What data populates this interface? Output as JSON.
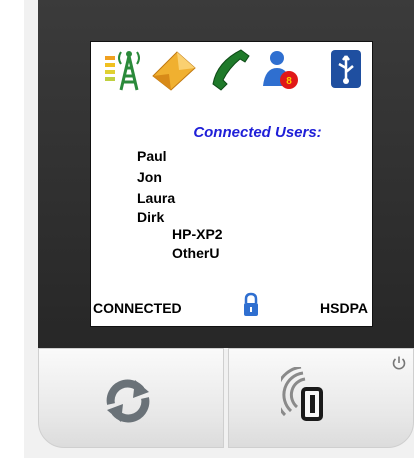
{
  "screen": {
    "title": "Connected Users:",
    "users": [
      "Paul",
      "Jon",
      "Laura",
      "Dirk"
    ],
    "sub_users": [
      "HP-XP2",
      "OtherU"
    ],
    "connection_status": "CONNECTED",
    "network_type": "HSDPA"
  },
  "icons": {
    "signal": "signal-tower-icon",
    "message": "envelope-icon",
    "call": "phone-handset-icon",
    "users": "users-icon",
    "usb": "usb-icon",
    "lock": "lock-icon",
    "refresh": "refresh-icon",
    "wps": "wps-icon",
    "power": "power-icon"
  },
  "colors": {
    "title": "#1f1fd8",
    "tower": "#2a8a3a",
    "envelope": "#f0a020",
    "phone": "#1f7a2a",
    "users_badge": "#e01818",
    "usb_bg": "#1f4fa0",
    "lock": "#2f6fd0",
    "refresh": "#6a7278"
  }
}
